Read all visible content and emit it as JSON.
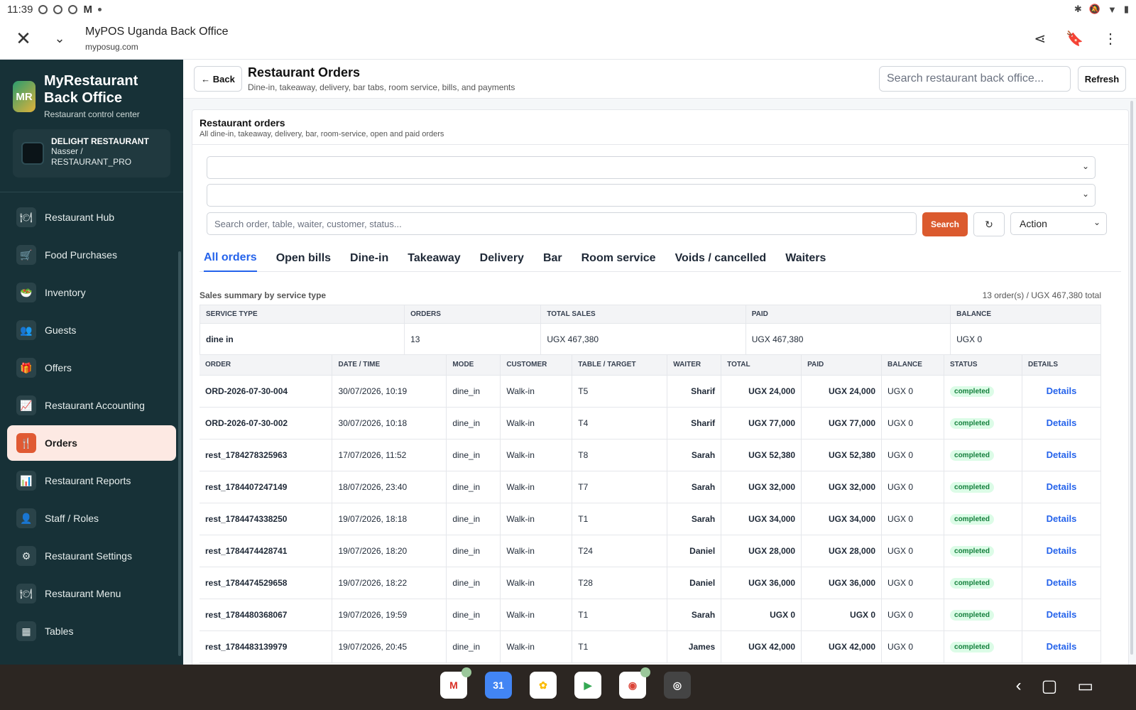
{
  "statusbar": {
    "time": "11:39"
  },
  "browser": {
    "title": "MyPOS Uganda Back Office",
    "url": "myposug.com"
  },
  "sidebar": {
    "logo": "MR",
    "brand_title_1": "MyRestaurant",
    "brand_title_2": "Back Office",
    "brand_sub": "Restaurant control center",
    "restaurant": {
      "name": "DELIGHT RESTAURANT",
      "user": "Nasser /",
      "role": "RESTAURANT_PRO"
    },
    "items": [
      {
        "label": "Restaurant Hub",
        "icon": "🍽"
      },
      {
        "label": "Food Purchases",
        "icon": "🛒"
      },
      {
        "label": "Inventory",
        "icon": "🥗"
      },
      {
        "label": "Guests",
        "icon": "👥"
      },
      {
        "label": "Offers",
        "icon": "🎁"
      },
      {
        "label": "Restaurant Accounting",
        "icon": "📈"
      },
      {
        "label": "Orders",
        "icon": "🍴"
      },
      {
        "label": "Restaurant Reports",
        "icon": "📊"
      },
      {
        "label": "Staff / Roles",
        "icon": "👤"
      },
      {
        "label": "Restaurant Settings",
        "icon": "⚙"
      },
      {
        "label": "Restaurant Menu",
        "icon": "🍽"
      },
      {
        "label": "Tables",
        "icon": "▦"
      }
    ]
  },
  "header": {
    "back": "← Back",
    "title": "Restaurant Orders",
    "subtitle": "Dine-in, takeaway, delivery, bar tabs, room service, bills, and payments",
    "search_placeholder": "Search restaurant back office...",
    "refresh": "Refresh"
  },
  "panel": {
    "title": "Restaurant orders",
    "subtitle": "All dine-in, takeaway, delivery, bar, room-service, open and paid orders",
    "search_placeholder": "Search order, table, waiter, customer, status...",
    "search_btn": "Search",
    "reload": "↻",
    "action": "Action"
  },
  "tabs": [
    "All orders",
    "Open bills",
    "Dine-in",
    "Takeaway",
    "Delivery",
    "Bar",
    "Room service",
    "Voids / cancelled",
    "Waiters"
  ],
  "summary": {
    "label": "Sales summary by service type",
    "total": "13 order(s) / UGX 467,380 total",
    "headers": [
      "SERVICE TYPE",
      "ORDERS",
      "TOTAL SALES",
      "PAID",
      "BALANCE"
    ],
    "rows": [
      [
        "dine in",
        "13",
        "UGX 467,380",
        "UGX 467,380",
        "UGX 0"
      ]
    ]
  },
  "orders": {
    "headers": [
      "ORDER",
      "DATE / TIME",
      "MODE",
      "CUSTOMER",
      "TABLE / TARGET",
      "WAITER",
      "TOTAL",
      "PAID",
      "BALANCE",
      "STATUS",
      "DETAILS"
    ],
    "rows": [
      [
        "ORD-2026-07-30-004",
        "30/07/2026, 10:19",
        "dine_in",
        "Walk-in",
        "T5",
        "Sharif",
        "UGX 24,000",
        "UGX 24,000",
        "UGX 0",
        "completed",
        "Details"
      ],
      [
        "ORD-2026-07-30-002",
        "30/07/2026, 10:18",
        "dine_in",
        "Walk-in",
        "T4",
        "Sharif",
        "UGX 77,000",
        "UGX 77,000",
        "UGX 0",
        "completed",
        "Details"
      ],
      [
        "rest_1784278325963",
        "17/07/2026, 11:52",
        "dine_in",
        "Walk-in",
        "T8",
        "Sarah",
        "UGX 52,380",
        "UGX 52,380",
        "UGX 0",
        "completed",
        "Details"
      ],
      [
        "rest_1784407247149",
        "18/07/2026, 23:40",
        "dine_in",
        "Walk-in",
        "T7",
        "Sarah",
        "UGX 32,000",
        "UGX 32,000",
        "UGX 0",
        "completed",
        "Details"
      ],
      [
        "rest_1784474338250",
        "19/07/2026, 18:18",
        "dine_in",
        "Walk-in",
        "T1",
        "Sarah",
        "UGX 34,000",
        "UGX 34,000",
        "UGX 0",
        "completed",
        "Details"
      ],
      [
        "rest_1784474428741",
        "19/07/2026, 18:20",
        "dine_in",
        "Walk-in",
        "T24",
        "Daniel",
        "UGX 28,000",
        "UGX 28,000",
        "UGX 0",
        "completed",
        "Details"
      ],
      [
        "rest_1784474529658",
        "19/07/2026, 18:22",
        "dine_in",
        "Walk-in",
        "T28",
        "Daniel",
        "UGX 36,000",
        "UGX 36,000",
        "UGX 0",
        "completed",
        "Details"
      ],
      [
        "rest_1784480368067",
        "19/07/2026, 19:59",
        "dine_in",
        "Walk-in",
        "T1",
        "Sarah",
        "UGX 0",
        "UGX 0",
        "UGX 0",
        "completed",
        "Details"
      ],
      [
        "rest_1784483139979",
        "19/07/2026, 20:45",
        "dine_in",
        "Walk-in",
        "T1",
        "James",
        "UGX 42,000",
        "UGX 42,000",
        "UGX 0",
        "completed",
        "Details"
      ]
    ]
  },
  "dock": [
    {
      "name": "gmail-app-icon",
      "glyph": "M",
      "bg": "#ffffff",
      "fg": "#d93025"
    },
    {
      "name": "calendar-app-icon",
      "glyph": "31",
      "bg": "#4285f4",
      "fg": "#ffffff"
    },
    {
      "name": "photos-app-icon",
      "glyph": "✿",
      "bg": "#ffffff",
      "fg": "#fbbc04"
    },
    {
      "name": "play-store-app-icon",
      "glyph": "▶",
      "bg": "#ffffff",
      "fg": "#34a853"
    },
    {
      "name": "chrome-app-icon",
      "glyph": "◉",
      "bg": "#ffffff",
      "fg": "#db4437"
    },
    {
      "name": "camera-app-icon",
      "glyph": "◎",
      "bg": "#444444",
      "fg": "#ffffff"
    }
  ]
}
